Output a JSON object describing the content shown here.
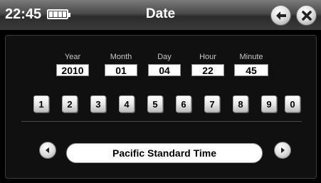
{
  "status_bar": {
    "time": "22:45",
    "battery_icon": "battery-full-icon"
  },
  "header": {
    "title": "Date",
    "back_icon": "back-arrow-icon",
    "close_icon": "close-icon"
  },
  "date_fields": [
    {
      "label": "Year",
      "value": "2010"
    },
    {
      "label": "Month",
      "value": "01"
    },
    {
      "label": "Day",
      "value": "04"
    },
    {
      "label": "Hour",
      "value": "22"
    },
    {
      "label": "Minute",
      "value": "45"
    }
  ],
  "keypad": [
    "1",
    "2",
    "3",
    "4",
    "5",
    "6",
    "7",
    "8",
    "9",
    "0"
  ],
  "timezone": {
    "label": "Pacific Standard Time",
    "prev_icon": "arrow-left-icon",
    "next_icon": "arrow-right-icon"
  },
  "colors": {
    "background": "#000000",
    "field_bg": "#ffffff",
    "label_text": "#c8c8c8"
  }
}
